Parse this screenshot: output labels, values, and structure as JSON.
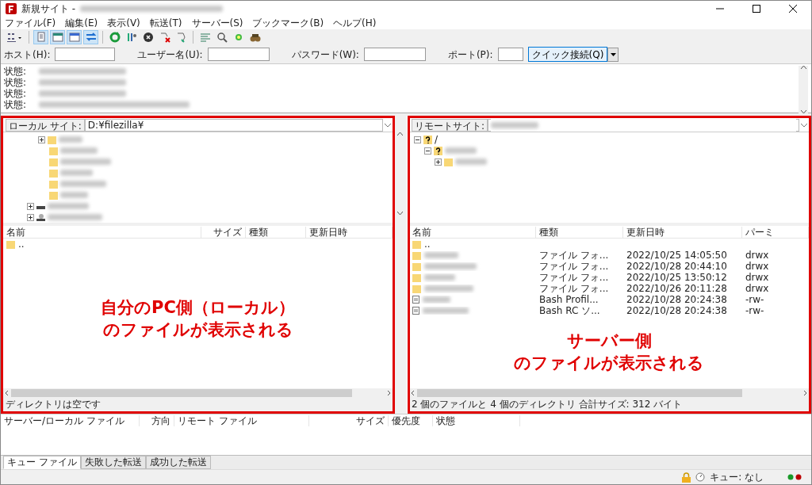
{
  "window": {
    "title": "新規サイト -"
  },
  "menu": [
    "ファイル(F)",
    "編集(E)",
    "表示(V)",
    "転送(T)",
    "サーバー(S)",
    "ブックマーク(B)",
    "ヘルプ(H)"
  ],
  "toolbar": [
    {
      "pressed": false
    },
    {
      "pressed": true
    },
    {
      "pressed": true
    },
    {
      "pressed": true
    },
    {
      "pressed": true
    },
    {
      "pressed": false
    },
    {
      "pressed": false
    },
    {
      "pressed": false
    },
    {
      "pressed": false
    },
    {
      "pressed": false
    },
    {
      "pressed": false
    },
    {
      "pressed": false
    },
    {
      "pressed": false
    },
    {
      "pressed": false
    }
  ],
  "quickconnect": {
    "fields": [
      {
        "label": "ホスト(H):"
      },
      {
        "label": "ユーザー名(U):"
      },
      {
        "label": "パスワード(W):"
      },
      {
        "label": "ポート(P):"
      }
    ],
    "button": "クイック接続(Q)"
  },
  "log": [
    {
      "label": "状態:"
    },
    {
      "label": "状態:"
    },
    {
      "label": "状態:"
    },
    {
      "label": "状態:"
    }
  ],
  "local": {
    "site_label": "ローカル サイト:",
    "path": "D:¥filezilla¥",
    "tree": [
      {
        "kind": "folder",
        "expanded": false
      },
      {
        "kind": "folder"
      },
      {
        "kind": "folder"
      },
      {
        "kind": "folder"
      },
      {
        "kind": "folder"
      },
      {
        "kind": "folder"
      },
      {
        "kind": "drive",
        "expanded": false
      },
      {
        "kind": "network",
        "expanded": false
      }
    ],
    "columns": [
      "名前",
      "サイズ",
      "種類",
      "更新日時"
    ],
    "rows": [
      {
        "kind": "folder",
        "name": ".."
      }
    ],
    "status": "ディレクトリは空です",
    "annotation": [
      "自分のPC側（ローカル）",
      "のファイルが表示される"
    ]
  },
  "remote": {
    "site_label": "リモートサイト:",
    "tree": [
      {
        "kind": "unknown",
        "label": "/",
        "expanded": true,
        "children": [
          {
            "kind": "unknown",
            "expanded": true,
            "children": [
              {
                "kind": "folder",
                "expanded": false
              }
            ]
          }
        ]
      }
    ],
    "columns": [
      "名前",
      "種類",
      "更新日時",
      "パーミ"
    ],
    "rows": [
      {
        "kind": "folder",
        "name": ".."
      },
      {
        "kind": "folder",
        "type": "ファイル フォ...",
        "modified": "2022/10/25 14:05:50",
        "perms": "drwx"
      },
      {
        "kind": "folder",
        "type": "ファイル フォ...",
        "modified": "2022/10/28 20:44:10",
        "perms": "drwx"
      },
      {
        "kind": "folder",
        "type": "ファイル フォ...",
        "modified": "2022/10/25 13:50:12",
        "perms": "drwx"
      },
      {
        "kind": "folder",
        "type": "ファイル フォ...",
        "modified": "2022/10/26 20:11:28",
        "perms": "drwx"
      },
      {
        "kind": "file",
        "type": "Bash Profil...",
        "modified": "2022/10/28 20:24:38",
        "perms": "-rw-"
      },
      {
        "kind": "file",
        "type": "Bash RC ソ...",
        "modified": "2022/10/28 20:24:38",
        "perms": "-rw-"
      }
    ],
    "status": "2 個のファイルと 4 個のディレクトリ 合計サイズ: 312 バイト",
    "annotation": [
      "サーバー側",
      "のファイルが表示される"
    ]
  },
  "queue": {
    "columns": [
      "サーバー/ローカル ファイル",
      "方向",
      "リモート ファイル",
      "サイズ",
      "優先度",
      "状態"
    ]
  },
  "tabs": [
    {
      "label": "キュー ファイル",
      "selected": true
    },
    {
      "label": "失敗した転送",
      "selected": false
    },
    {
      "label": "成功した転送",
      "selected": false
    }
  ],
  "status_bar": {
    "queue": "キュー: なし"
  }
}
